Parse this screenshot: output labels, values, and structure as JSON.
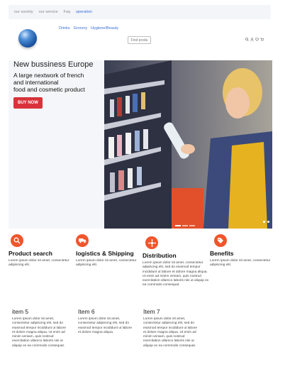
{
  "topnav": {
    "items": [
      "our society",
      "our service",
      "Faq",
      "operation"
    ]
  },
  "header": {
    "categories": [
      "Drinks",
      "Grocery",
      "Hygiene/Beauty"
    ],
    "find_button": "Find produ",
    "tool_icons": [
      "search-icon",
      "user-icon",
      "heart-icon",
      "cart-icon"
    ]
  },
  "hero": {
    "title": "New bussiness Europe",
    "subtitle_line1": "A large nextwork of french",
    "subtitle_line2": "and international",
    "subtitle_line3": "food and cosmetic product",
    "buy_label": "BUY NOW"
  },
  "features": [
    {
      "icon": "search-icon",
      "title": "Product search",
      "text": "Lorem ipsum dolor sit amet, consectetur adipiscing elit."
    },
    {
      "icon": "truck-icon",
      "title": "logistics & Shipping",
      "text": "Lorem ipsum dolor sit amet, consectetur adipiscing elit."
    },
    {
      "icon": "network-icon",
      "title": "Distribution",
      "text": "Lorem ipsum dolor sit amet, consectetur adipiscing elit, sed do eiusmod tempor incididunt ut labore et dolore magna aliqua. Ut enim ad minim veniam, quis nostrud exercitation ullamco laboris nisi ut aliquip ex ea commodo consequat."
    },
    {
      "icon": "tag-icon",
      "title": "Benefits",
      "text": "Lorem ipsum dolor sit amet, consectetur adipiscing elit."
    }
  ],
  "items": [
    {
      "title": "item 5",
      "text": "Lorem ipsum dolor sit amet, consectetur adipiscing elit, sed do eiusmod tempor incididunt ut labore et dolore magna aliqua. Ut enim ad minim veniam, quis nostrud exercitation ullamco laboris nisi ut aliquip ex ea commodo consequat."
    },
    {
      "title": "Item 6",
      "text": "Lorem ipsum dolor sit amet, consectetur adipiscing elit, sed do eiusmod tempor incididunt ut labore et dolore magna aliqua."
    },
    {
      "title": "Item 7",
      "text": "Lorem ipsum dolor sit amet, consectetur adipiscing elit, sed do eiusmod tempor incididunt ut labore et dolore magna aliqua. Ut enim ad minim veniam, quis nostrud exercitation ullamco laboris nisi ut aliquip ex ea commodo consequat."
    }
  ]
}
